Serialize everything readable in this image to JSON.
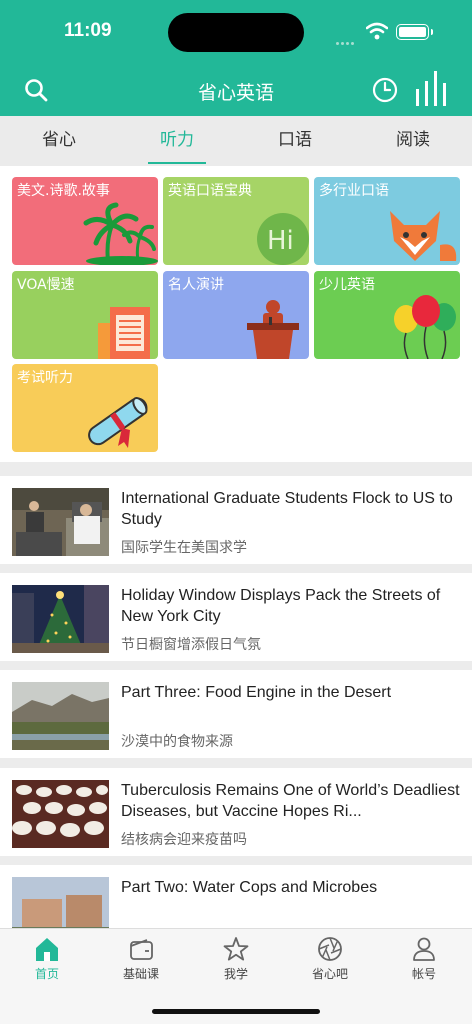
{
  "status": {
    "time": "11:09"
  },
  "header": {
    "title": "省心英语",
    "icons": [
      "search-icon",
      "history-icon",
      "audio-bars-icon"
    ]
  },
  "tabs": [
    {
      "label": "省心",
      "active": false
    },
    {
      "label": "听力",
      "active": true
    },
    {
      "label": "口语",
      "active": false
    },
    {
      "label": "阅读",
      "active": false
    }
  ],
  "categories": [
    {
      "label": "美文.诗歌.故事",
      "color": "#f26d7a",
      "icon": "palm-tree-icon"
    },
    {
      "label": "英语口语宝典",
      "color": "#a6d466",
      "icon": "speech-bubble-icon"
    },
    {
      "label": "多行业口语",
      "color": "#7dcbe0",
      "icon": "fox-icon"
    },
    {
      "label": "VOA慢速",
      "color": "#98d05e",
      "icon": "document-icon"
    },
    {
      "label": "名人演讲",
      "color": "#8ea7ee",
      "icon": "podium-icon"
    },
    {
      "label": "少儿英语",
      "color": "#6ccd52",
      "icon": "balloons-icon"
    },
    {
      "label": "考试听力",
      "color": "#f8cc58",
      "icon": "diploma-icon"
    }
  ],
  "articles": [
    {
      "title": "International Graduate Students Flock to US to Study",
      "subtitle": "国际学生在美国求学"
    },
    {
      "title": "Holiday Window Displays Pack the Streets of New York City",
      "subtitle": "节日橱窗增添假日气氛"
    },
    {
      "title": "Part Three: Food Engine in the Desert",
      "subtitle": "沙漠中的食物来源"
    },
    {
      "title": "Tuberculosis Remains One of World’s Deadliest Diseases, but Vaccine Hopes Ri...",
      "subtitle": "结核病会迎来疫苗吗"
    },
    {
      "title": "Part Two: Water Cops and Microbes",
      "subtitle": ""
    }
  ],
  "bottom_nav": [
    {
      "label": "首页",
      "active": true,
      "icon": "home-icon"
    },
    {
      "label": "基础课",
      "active": false,
      "icon": "wallet-icon"
    },
    {
      "label": "我学",
      "active": false,
      "icon": "star-icon"
    },
    {
      "label": "省心吧",
      "active": false,
      "icon": "aperture-icon"
    },
    {
      "label": "帐号",
      "active": false,
      "icon": "user-icon"
    }
  ],
  "colors": {
    "accent": "#22b898"
  }
}
